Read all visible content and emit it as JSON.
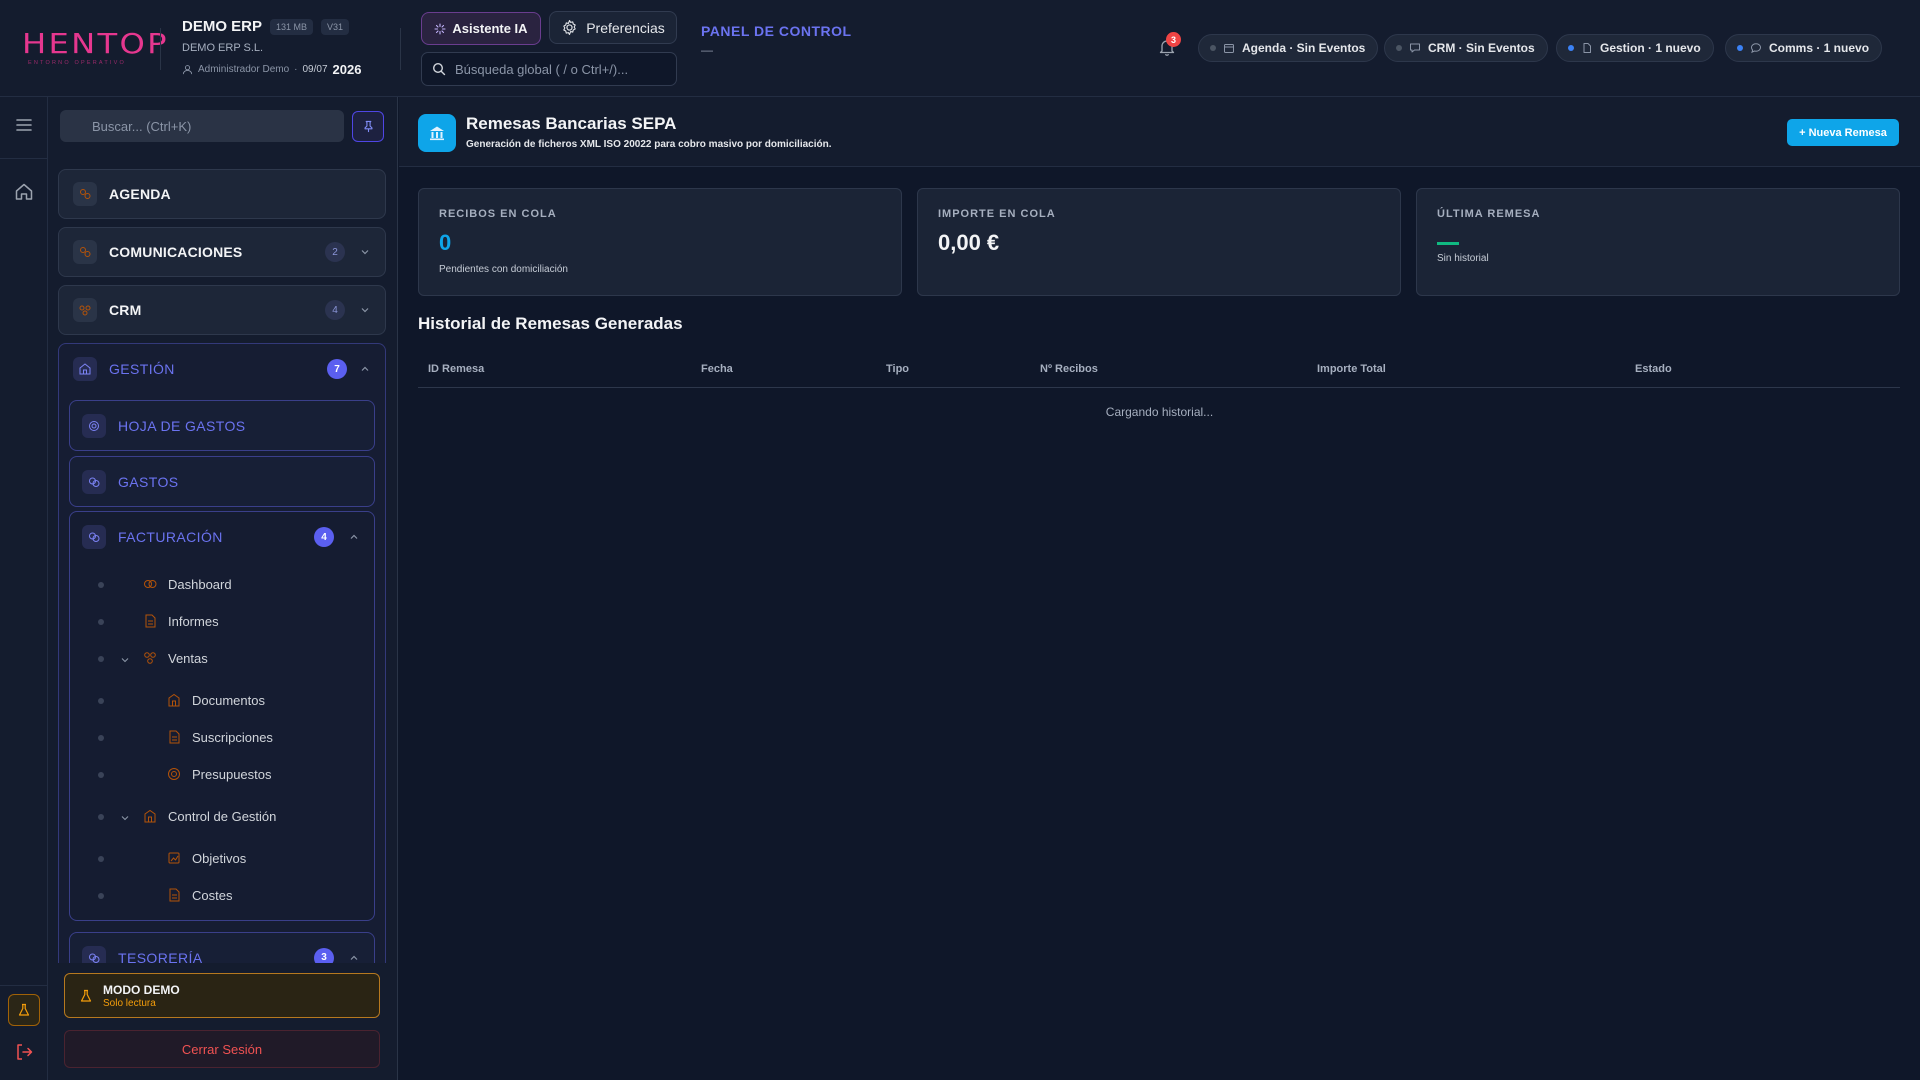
{
  "brand": {
    "logo_word": "HENTOP",
    "logo_sub": "ENTORNO OPERATIVO",
    "color": "#e6378f"
  },
  "company": {
    "name": "DEMO ERP",
    "size_tag": "131 MB",
    "version_tag": "V31",
    "legal_name": "DEMO ERP S.L.",
    "user": "Administrador Demo",
    "date": "09/07",
    "year": "2026"
  },
  "header": {
    "ai_button": "Asistente IA",
    "prefs_button": "Preferencias",
    "search_placeholder": "Búsqueda global ( / o Ctrl+/)...",
    "panel_title": "PANEL DE CONTROL",
    "panel_sub": "—",
    "notifications_count": "3",
    "pills": [
      {
        "label": "Agenda · Sin Eventos",
        "dot": "#4b5563",
        "icon": "calendar-icon"
      },
      {
        "label": "CRM · Sin Eventos",
        "dot": "#4b5563",
        "icon": "chat-icon"
      },
      {
        "label": "Gestion · 1 nuevo",
        "dot": "#3b82f6",
        "icon": "file-icon"
      },
      {
        "label": "Comms · 1 nuevo",
        "dot": "#3b82f6",
        "icon": "message-icon"
      }
    ]
  },
  "sidebar": {
    "search_placeholder": "Buscar... (Ctrl+K)",
    "items": [
      {
        "label": "AGENDA"
      },
      {
        "label": "COMUNICACIONES",
        "count": "2"
      },
      {
        "label": "CRM",
        "count": "4"
      }
    ],
    "gestion": {
      "label": "GESTIÓN",
      "count": "7",
      "sub": [
        {
          "label": "HOJA DE GASTOS"
        },
        {
          "label": "GASTOS"
        }
      ],
      "facturacion": {
        "label": "FACTURACIÓN",
        "count": "4",
        "tree": [
          {
            "label": "Dashboard"
          },
          {
            "label": "Informes"
          },
          {
            "label": "Ventas"
          },
          {
            "label": "Documentos"
          },
          {
            "label": "Suscripciones"
          },
          {
            "label": "Presupuestos"
          },
          {
            "label": "Control de Gestión"
          },
          {
            "label": "Objetivos"
          },
          {
            "label": "Costes"
          }
        ]
      },
      "tesoreria": {
        "label": "TESORERÍA",
        "count": "3"
      }
    },
    "demo": {
      "title": "MODO DEMO",
      "sub": "Solo lectura"
    },
    "logout": "Cerrar Sesión"
  },
  "page": {
    "title": "Remesas Bancarias SEPA",
    "subtitle": "Generación de ficheros XML ISO 20022 para cobro masivo por domiciliación.",
    "new_button": "+ Nueva Remesa",
    "accent": "#0ea5e9",
    "stats": [
      {
        "label": "RECIBOS EN COLA",
        "value": "0",
        "note": "Pendientes con domiciliación",
        "color": "#0ea5e9"
      },
      {
        "label": "IMPORTE EN COLA",
        "value": "0,00 €",
        "note": "",
        "color": "#f3f4f6"
      },
      {
        "label": "ÚLTIMA REMESA",
        "value": "",
        "note": "Sin historial",
        "color": "#10b981"
      }
    ],
    "history_title": "Historial de Remesas Generadas",
    "columns": [
      "ID Remesa",
      "Fecha",
      "Tipo",
      "Nº Recibos",
      "Importe Total",
      "Estado"
    ],
    "loading": "Cargando historial..."
  }
}
